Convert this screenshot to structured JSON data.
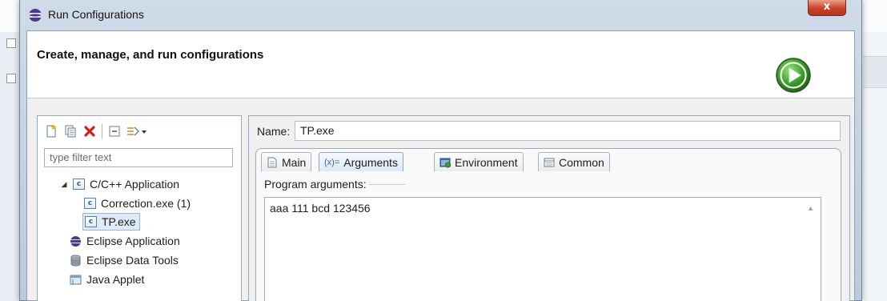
{
  "window": {
    "title": "Run Configurations",
    "close_glyph": "x"
  },
  "header": {
    "title": "Create, manage, and run configurations"
  },
  "left_pane": {
    "filter_placeholder": "type filter text",
    "tree": [
      {
        "label": "C/C++ Application",
        "expanded": true,
        "icon": "c-cpp-app-icon"
      },
      {
        "label": "Correction.exe (1)",
        "icon": "c-config-icon"
      },
      {
        "label": "TP.exe",
        "icon": "c-config-icon",
        "selected": true
      },
      {
        "label": "Eclipse Application",
        "icon": "eclipse-icon"
      },
      {
        "label": "Eclipse Data Tools",
        "icon": "database-icon"
      },
      {
        "label": "Java Applet",
        "icon": "applet-icon"
      }
    ]
  },
  "right_pane": {
    "name_label": "Name:",
    "name_value": "TP.exe",
    "tabs": [
      {
        "label": "Main",
        "icon": "main-tab-icon"
      },
      {
        "label": "Arguments",
        "icon": "arguments-tab-icon",
        "prefix": "(x)=",
        "active": true
      },
      {
        "label": "Environment",
        "icon": "environment-tab-icon"
      },
      {
        "label": "Common",
        "icon": "common-tab-icon"
      }
    ],
    "program_arguments_label": "Program arguments:",
    "program_arguments_value": "aaa 111 bcd 123456"
  },
  "colors": {
    "accent": "#3c8a2e",
    "selection": "#dfeaf7",
    "close_button": "#c7432a"
  }
}
